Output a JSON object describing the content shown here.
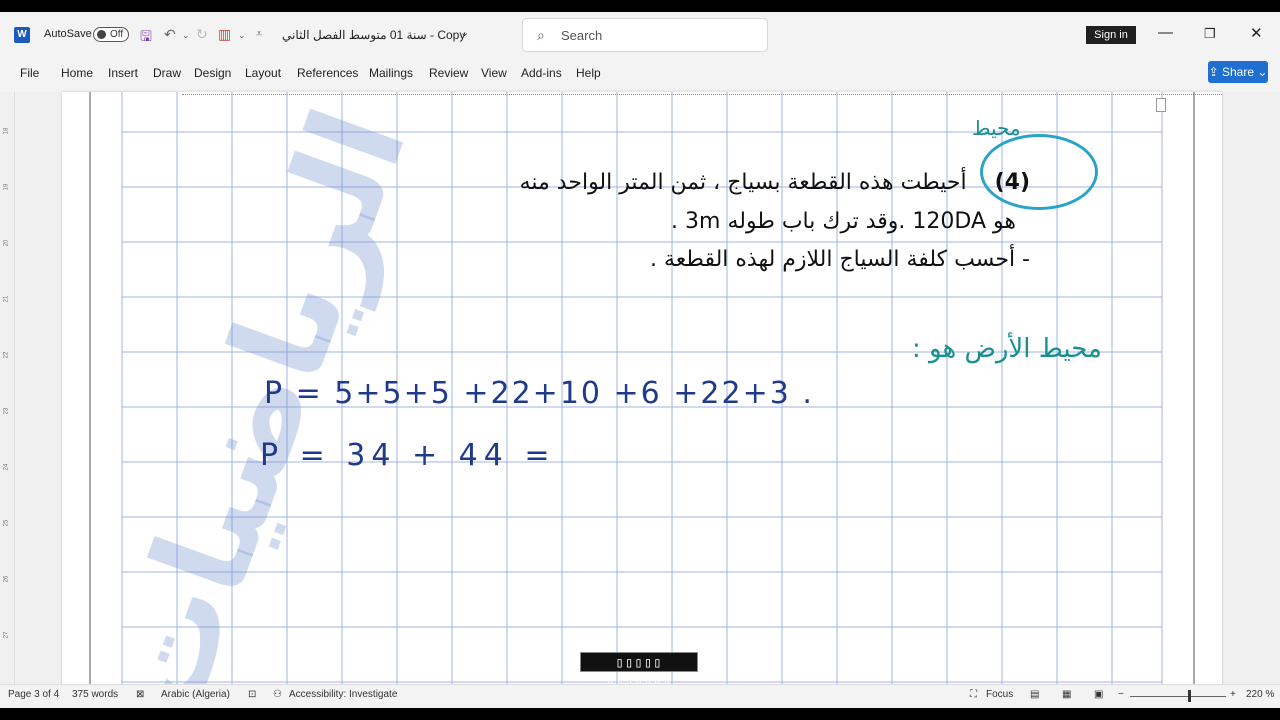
{
  "titlebar": {
    "app_icon": "word-icon",
    "app_icon_letter": "W",
    "autosave_label": "AutoSave",
    "autosave_state": "Off",
    "doc_title": "سنة 01 متوسط الفصل الثاني - Copy",
    "search_placeholder": "Search",
    "sign_in": "Sign in",
    "minimize": "—",
    "restore": "❐",
    "close": "✕"
  },
  "ribbon": {
    "menu": [
      "File",
      "Home",
      "Insert",
      "Draw",
      "Design",
      "Layout",
      "References",
      "Mailings",
      "Review",
      "View",
      "Add-ins",
      "Help"
    ],
    "share": "Share"
  },
  "document": {
    "exercise_number": "(4)",
    "line1_rest": "أحيطت هذه القطعة بسياج ، ثمن المتر الواحد منه",
    "line2": "هو 120DA .وقد ترك باب طوله 3m .",
    "line3": "-  أحسب كلفة السياج اللازم لهذه القطعة .",
    "hw_title": "محيط",
    "hw_perimeter": "محيط الأرض هو :",
    "hw_equation1": "P = 5+5+5 +22+10 +6 +22+3 .",
    "hw_equation2": "P = 34 + 44 ="
  },
  "caption": "▯▯▯▯▯ ▯▯▯▯▯▯▯",
  "ruler_numbers": [
    "18",
    "19",
    "20",
    "21",
    "22",
    "23",
    "24",
    "25",
    "26",
    "27"
  ],
  "status": {
    "page": "Page 3 of 4",
    "words": "375 words",
    "language": "Arabic (Algeria)",
    "accessibility": "Accessibility: Investigate",
    "focus": "Focus",
    "zoom": "220 %"
  },
  "colors": {
    "accent": "#185abd",
    "grid": "#9fb3e0",
    "handwriting": "#1f3a8a",
    "highlight_circle": "#2aa3c9"
  }
}
